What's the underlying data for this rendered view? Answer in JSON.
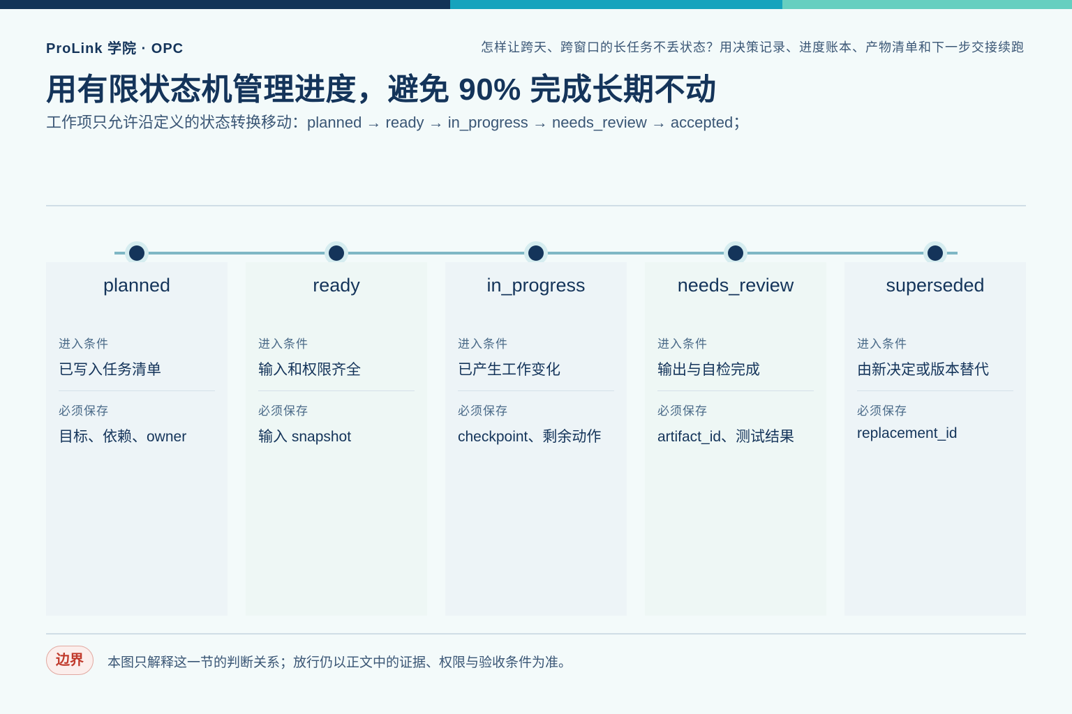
{
  "colors": {
    "topbar": [
      "#123457",
      "#16a3bd",
      "#66cfc0"
    ],
    "primary": "#14345a",
    "accent_rail": "#7fb7c5",
    "badge_red": "#c0392b"
  },
  "header": {
    "brand": "ProLink 学院 · OPC",
    "tagline": "怎样让跨天、跨窗口的长任务不丢状态？用决策记录、进度账本、产物清单和下一步交接续跑",
    "title": "用有限状态机管理进度，避免 90% 完成长期不动",
    "subtitle": "工作项只允许沿定义的状态转换移动：planned → ready → in_progress → needs_review → accepted；"
  },
  "states": [
    {
      "name": "planned",
      "enter_label": "进入条件",
      "enter": "已写入任务清单",
      "save_label": "必须保存",
      "save": "目标、依赖、owner"
    },
    {
      "name": "ready",
      "enter_label": "进入条件",
      "enter": "输入和权限齐全",
      "save_label": "必须保存",
      "save": "输入 snapshot"
    },
    {
      "name": "in_progress",
      "enter_label": "进入条件",
      "enter": "已产生工作变化",
      "save_label": "必须保存",
      "save": "checkpoint、剩余动作"
    },
    {
      "name": "needs_review",
      "enter_label": "进入条件",
      "enter": "输出与自检完成",
      "save_label": "必须保存",
      "save": "artifact_id、测试结果"
    },
    {
      "name": "superseded",
      "enter_label": "进入条件",
      "enter": "由新决定或版本替代",
      "save_label": "必须保存",
      "save": "replacement_id"
    }
  ],
  "footer": {
    "badge": "边界",
    "note": "本图只解释这一节的判断关系；放行仍以正文中的证据、权限与验收条件为准。"
  }
}
